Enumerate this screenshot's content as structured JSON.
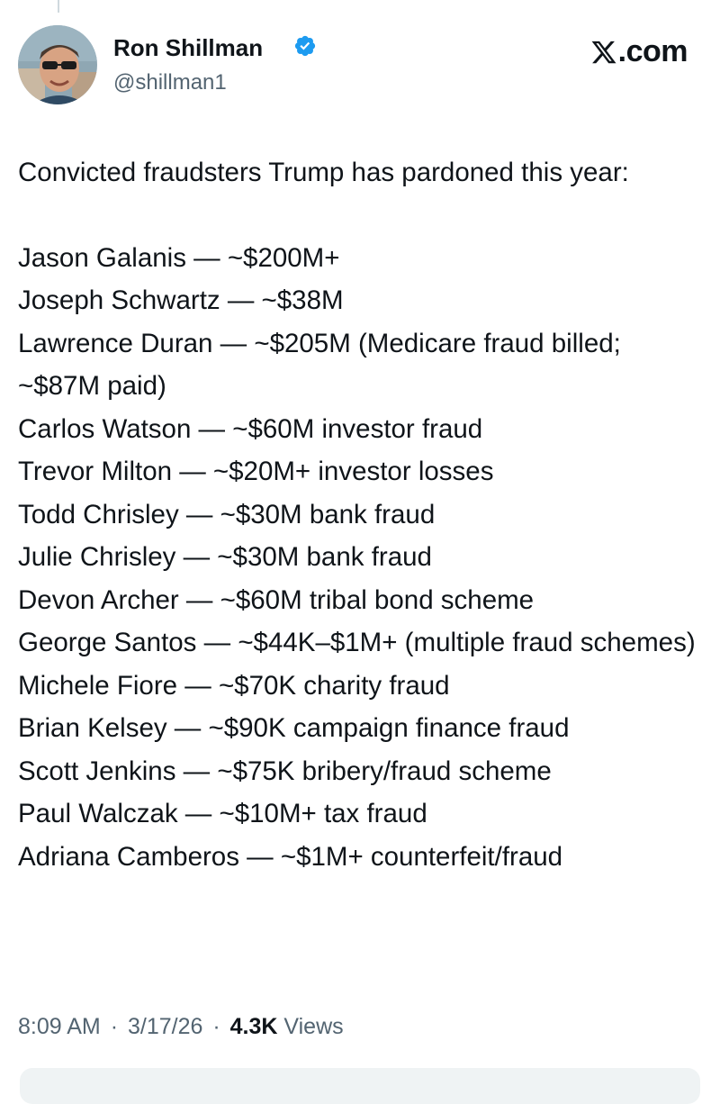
{
  "colors": {
    "text_primary": "#0f1419",
    "text_secondary": "#536471",
    "verified_blue": "#1d9bf0",
    "reply_box_bg": "#eff3f4"
  },
  "header": {
    "author_name": "Ron Shillman",
    "handle": "@shillman1",
    "verified_icon": "verified-badge-icon",
    "source_logo": "x-logo-icon",
    "source_text": ".com"
  },
  "tweet": {
    "intro": "Convicted fraudsters Trump has pardoned this year:",
    "entries": [
      "Jason Galanis — ~$200M+",
      "Joseph Schwartz — ~$38M",
      "Lawrence Duran — ~$205M (Medicare fraud billed; ~$87M paid)",
      "Carlos Watson — ~$60M investor fraud",
      "Trevor Milton — ~$20M+ investor losses",
      "Todd Chrisley — ~$30M bank fraud",
      "Julie Chrisley — ~$30M bank fraud",
      "Devon Archer — ~$60M tribal bond scheme",
      "George Santos — ~$44K–$1M+ (multiple fraud schemes)",
      "Michele Fiore — ~$70K charity fraud",
      "Brian Kelsey — ~$90K campaign finance fraud",
      "Scott Jenkins — ~$75K bribery/fraud scheme",
      "Paul Walczak — ~$10M+ tax fraud",
      "Adriana Camberos — ~$1M+ counterfeit/fraud"
    ]
  },
  "meta": {
    "time": "8:09 AM",
    "date": "3/17/26",
    "separator": "·",
    "views_count": "4.3K",
    "views_label": "Views"
  }
}
